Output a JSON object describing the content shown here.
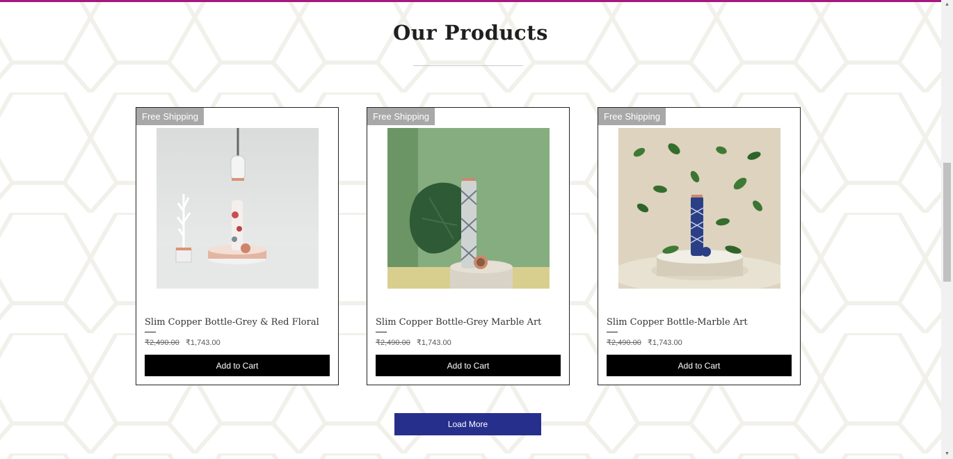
{
  "section": {
    "title": "Our Products"
  },
  "products": [
    {
      "badge": "Free Shipping",
      "name": "Slim Copper Bottle-Grey & Red Floral",
      "old_price": "₹2,490.00",
      "price": "₹1,743.00",
      "button_label": "Add to Cart"
    },
    {
      "badge": "Free Shipping",
      "name": "Slim Copper Bottle-Grey Marble Art",
      "old_price": "₹2,490.00",
      "price": "₹1,743.00",
      "button_label": "Add to Cart"
    },
    {
      "badge": "Free Shipping",
      "name": "Slim Copper Bottle-Marble Art",
      "old_price": "₹2,490.00",
      "price": "₹1,743.00",
      "button_label": "Add to Cart"
    }
  ],
  "load_more_label": "Load More",
  "colors": {
    "accent_bar": "#a8177f",
    "load_more": "#262f8c",
    "badge": "#a8a8a8",
    "button": "#000000"
  },
  "icons": {
    "scroll_up": "triangle-up-icon",
    "scroll_down": "triangle-down-icon"
  }
}
